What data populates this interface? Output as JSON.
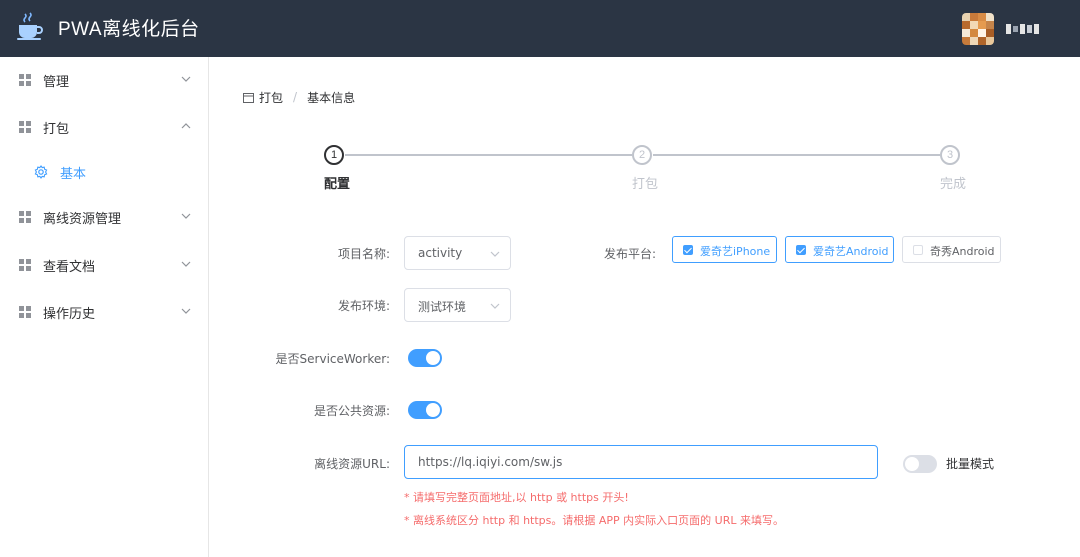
{
  "header": {
    "title": "PWA离线化后台",
    "logo_icon": "coffee-cup-icon",
    "avatar_icon": "user-avatar",
    "bg_color": "#2b3544"
  },
  "sidebar": {
    "items": [
      {
        "label": "管理",
        "icon": "grid-icon",
        "expanded": false
      },
      {
        "label": "打包",
        "icon": "grid-icon",
        "expanded": true
      },
      {
        "label": "离线资源管理",
        "icon": "grid-icon",
        "expanded": false
      },
      {
        "label": "查看文档",
        "icon": "grid-icon",
        "expanded": false
      },
      {
        "label": "操作历史",
        "icon": "grid-icon",
        "expanded": false
      }
    ],
    "sub_item": {
      "label": "基本",
      "icon": "gear-icon",
      "active": true
    }
  },
  "breadcrumb": {
    "items": [
      "打包",
      "基本信息"
    ],
    "separator": "/"
  },
  "steps": {
    "items": [
      {
        "number": "1",
        "title": "配置",
        "active": true
      },
      {
        "number": "2",
        "title": "打包",
        "active": false
      },
      {
        "number": "3",
        "title": "完成",
        "active": false
      }
    ]
  },
  "form": {
    "project_name_label": "项目名称:",
    "project_name_value": "activity",
    "env_label": "发布环境:",
    "env_value": "测试环境",
    "platform_label": "发布平台:",
    "platforms": [
      {
        "label": "爱奇艺iPhone",
        "checked": true
      },
      {
        "label": "爱奇艺Android",
        "checked": true
      },
      {
        "label": "奇秀Android",
        "checked": false
      }
    ],
    "service_worker_label": "是否ServiceWorker:",
    "service_worker_on": true,
    "public_resource_label": "是否公共资源:",
    "public_resource_on": true,
    "url_label": "离线资源URL:",
    "url_value": "https://lq.iqiyi.com/sw.js",
    "batch_mode_label": "批量模式",
    "batch_mode_on": false,
    "hints": [
      "* 请填写完整页面地址,以 http 或 https 开头!",
      "* 离线系统区分 http 和 https。请根据 APP 内实际入口页面的 URL 来填写。"
    ]
  },
  "colors": {
    "primary": "#409eff",
    "danger": "#f56c6c",
    "text": "#303133",
    "muted": "#c0c4cc"
  }
}
